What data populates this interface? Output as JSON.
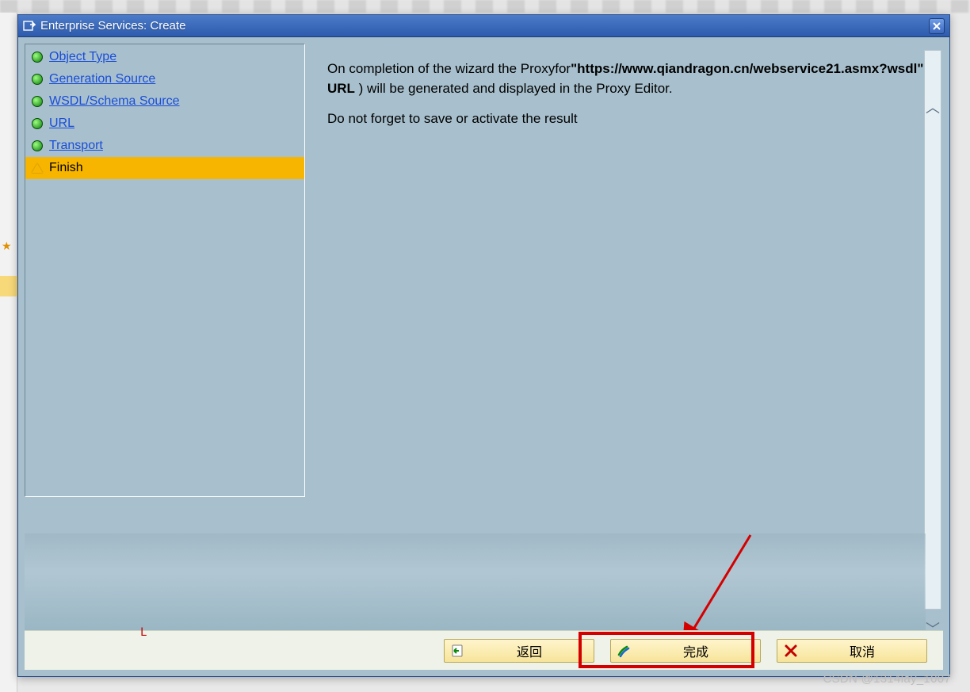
{
  "dialog": {
    "title": "Enterprise Services: Create"
  },
  "steps": [
    {
      "label": "Object Type",
      "state": "done"
    },
    {
      "label": "Generation Source",
      "state": "done"
    },
    {
      "label": "WSDL/Schema Source",
      "state": "done"
    },
    {
      "label": "URL",
      "state": "done"
    },
    {
      "label": "Transport",
      "state": "done"
    },
    {
      "label": "Finish",
      "state": "current"
    }
  ],
  "detail": {
    "line1_a": "On completion of the wizard the Proxyfor",
    "url": "\"https://www.qiandragon.cn/webservice21.asmx?wsdl\"",
    "line1_b": " ( ",
    "url_label": "URL",
    "line1_c": " ) will be generated and displayed in the Proxy Editor.",
    "line2": "Do not forget to save or activate the result"
  },
  "buttons": {
    "back": "返回",
    "finish": "完成",
    "cancel": "取消"
  },
  "watermark": "CSDN @1314lay_1007"
}
